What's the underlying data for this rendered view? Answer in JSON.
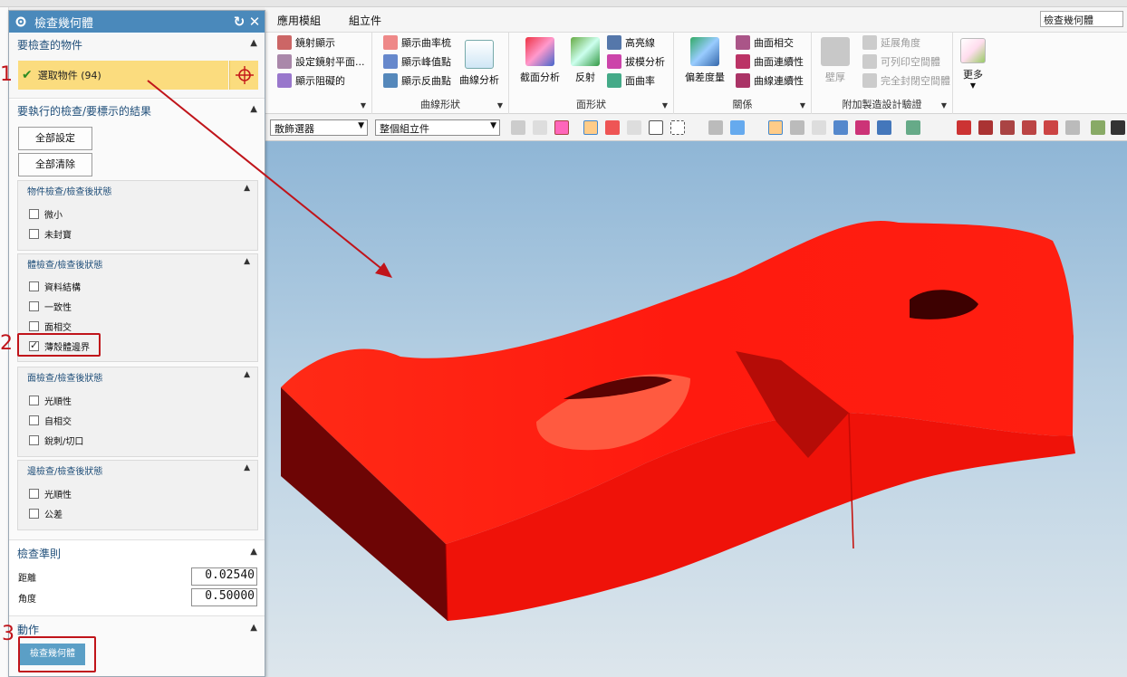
{
  "menubar": {
    "items": [
      "應用模組",
      "組立件"
    ],
    "search_value": "檢查幾何體"
  },
  "ribbon": {
    "group1": {
      "items": [
        "鏡射顯示",
        "設定鏡射平面...",
        "顯示阻礙的"
      ]
    },
    "group2": {
      "label": "曲線形狀",
      "items": [
        "顯示曲率梳",
        "顯示峰值點",
        "顯示反曲點"
      ],
      "big": "曲線分析"
    },
    "group3": {
      "label": "面形狀",
      "big1": "截面分析",
      "big2": "反射",
      "items": [
        "高亮線",
        "拔模分析",
        "面曲率"
      ]
    },
    "group4": {
      "label": "關係",
      "big": "偏差度量",
      "items": [
        "曲面相交",
        "曲面連續性",
        "曲線連續性"
      ]
    },
    "group5": {
      "label": "附加製造設計驗證",
      "big": "壁厚",
      "items": [
        "延展角度",
        "可列印空間體",
        "完全封閉空間體"
      ]
    },
    "more_label": "更多"
  },
  "toolbar2": {
    "filter_value": "散飾選器",
    "scope_value": "整個組立件"
  },
  "dialog": {
    "title": "檢查幾何體",
    "sec_objects": {
      "title": "要檢查的物件",
      "select_label": "選取物件 (94)"
    },
    "sec_checks": {
      "title": "要執行的檢查/要標示的結果",
      "set_all": "全部設定",
      "clear_all": "全部清除",
      "groups": [
        {
          "title": "物件檢查/檢查後狀態",
          "items": [
            {
              "label": "微小",
              "checked": false
            },
            {
              "label": "未封寶",
              "checked": false
            }
          ]
        },
        {
          "title": "體檢查/檢查後狀態",
          "items": [
            {
              "label": "資料結構",
              "checked": false
            },
            {
              "label": "一致性",
              "checked": false
            },
            {
              "label": "面相交",
              "checked": false
            },
            {
              "label": "薄殼體邊界",
              "checked": true
            }
          ]
        },
        {
          "title": "面檢查/檢查後狀態",
          "items": [
            {
              "label": "光順性",
              "checked": false
            },
            {
              "label": "自相交",
              "checked": false
            },
            {
              "label": "銳刺/切口",
              "checked": false
            }
          ]
        },
        {
          "title": "邊檢查/檢查後狀態",
          "items": [
            {
              "label": "光順性",
              "checked": false
            },
            {
              "label": "公差",
              "checked": false
            }
          ]
        }
      ]
    },
    "sec_criteria": {
      "title": "檢查準則",
      "distance_label": "距離",
      "distance_value": "0.02540",
      "angle_label": "角度",
      "angle_value": "0.50000"
    },
    "sec_action": {
      "title": "動作",
      "button": "檢查幾何體"
    }
  },
  "annotations": {
    "step1": "1",
    "step2": "2",
    "step3": "3"
  },
  "colors": {
    "dialog_title": "#4a89bb",
    "selection_highlight": "#fbdc7e",
    "part_red": "#ff1a0f",
    "annotation_red": "#c0141a"
  }
}
